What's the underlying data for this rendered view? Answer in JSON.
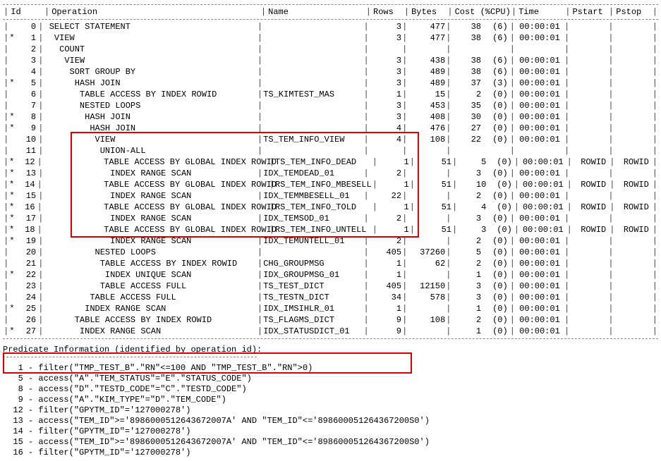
{
  "columns": {
    "id": "Id",
    "operation": "Operation",
    "name": "Name",
    "rows": "Rows",
    "bytes": "Bytes",
    "cost": "Cost (%CPU)",
    "time": "Time",
    "pstart": "Pstart",
    "pstop": "Pstop"
  },
  "plan": [
    {
      "star": "",
      "id": 0,
      "indent": 0,
      "op": "SELECT STATEMENT",
      "name": "",
      "rows": "3",
      "bytes": "477",
      "cost": "38",
      "cpu": "(6)",
      "time": "00:00:01",
      "pstart": "",
      "pstop": ""
    },
    {
      "star": "*",
      "id": 1,
      "indent": 1,
      "op": "VIEW",
      "name": "",
      "rows": "3",
      "bytes": "477",
      "cost": "38",
      "cpu": "(6)",
      "time": "00:00:01",
      "pstart": "",
      "pstop": ""
    },
    {
      "star": "",
      "id": 2,
      "indent": 2,
      "op": "COUNT",
      "name": "",
      "rows": "",
      "bytes": "",
      "cost": "",
      "cpu": "",
      "time": "",
      "pstart": "",
      "pstop": ""
    },
    {
      "star": "",
      "id": 3,
      "indent": 3,
      "op": "VIEW",
      "name": "",
      "rows": "3",
      "bytes": "438",
      "cost": "38",
      "cpu": "(6)",
      "time": "00:00:01",
      "pstart": "",
      "pstop": ""
    },
    {
      "star": "",
      "id": 4,
      "indent": 4,
      "op": "SORT GROUP BY",
      "name": "",
      "rows": "3",
      "bytes": "489",
      "cost": "38",
      "cpu": "(6)",
      "time": "00:00:01",
      "pstart": "",
      "pstop": ""
    },
    {
      "star": "*",
      "id": 5,
      "indent": 5,
      "op": "HASH JOIN",
      "name": "",
      "rows": "3",
      "bytes": "489",
      "cost": "37",
      "cpu": "(3)",
      "time": "00:00:01",
      "pstart": "",
      "pstop": ""
    },
    {
      "star": "",
      "id": 6,
      "indent": 6,
      "op": "TABLE ACCESS BY INDEX ROWID",
      "name": "TS_KIMTEST_MAS",
      "rows": "1",
      "bytes": "15",
      "cost": "2",
      "cpu": "(0)",
      "time": "00:00:01",
      "pstart": "",
      "pstop": ""
    },
    {
      "star": "",
      "id": 7,
      "indent": 6,
      "op": "NESTED LOOPS",
      "name": "",
      "rows": "3",
      "bytes": "453",
      "cost": "35",
      "cpu": "(0)",
      "time": "00:00:01",
      "pstart": "",
      "pstop": ""
    },
    {
      "star": "*",
      "id": 8,
      "indent": 7,
      "op": "HASH JOIN",
      "name": "",
      "rows": "3",
      "bytes": "408",
      "cost": "30",
      "cpu": "(0)",
      "time": "00:00:01",
      "pstart": "",
      "pstop": ""
    },
    {
      "star": "*",
      "id": 9,
      "indent": 8,
      "op": "HASH JOIN",
      "name": "",
      "rows": "4",
      "bytes": "476",
      "cost": "27",
      "cpu": "(0)",
      "time": "00:00:01",
      "pstart": "",
      "pstop": ""
    },
    {
      "star": "",
      "id": 10,
      "indent": 9,
      "op": "VIEW",
      "name": "TS_TEM_INFO_VIEW",
      "rows": "4",
      "bytes": "108",
      "cost": "22",
      "cpu": "(0)",
      "time": "00:00:01",
      "pstart": "",
      "pstop": ""
    },
    {
      "star": "",
      "id": 11,
      "indent": 10,
      "op": "UNION-ALL",
      "name": "",
      "rows": "",
      "bytes": "",
      "cost": "",
      "cpu": "",
      "time": "",
      "pstart": "",
      "pstop": ""
    },
    {
      "star": "*",
      "id": 12,
      "indent": 11,
      "op": "TABLE ACCESS BY GLOBAL INDEX ROWID",
      "name": "TS_TEM_INFO_DEAD",
      "rows": "1",
      "bytes": "51",
      "cost": "5",
      "cpu": "(0)",
      "time": "00:00:01",
      "pstart": "ROWID",
      "pstop": "ROWID"
    },
    {
      "star": "*",
      "id": 13,
      "indent": 12,
      "op": "INDEX RANGE SCAN",
      "name": "IDX_TEMDEAD_01",
      "rows": "2",
      "bytes": "",
      "cost": "3",
      "cpu": "(0)",
      "time": "00:00:01",
      "pstart": "",
      "pstop": ""
    },
    {
      "star": "*",
      "id": 14,
      "indent": 11,
      "op": "TABLE ACCESS BY GLOBAL INDEX ROWID",
      "name": "RS_TEM_INFO_MBESELL",
      "rows": "1",
      "bytes": "51",
      "cost": "10",
      "cpu": "(0)",
      "time": "00:00:01",
      "pstart": "ROWID",
      "pstop": "ROWID"
    },
    {
      "star": "*",
      "id": 15,
      "indent": 12,
      "op": "INDEX RANGE SCAN",
      "name": "IDX_TEMMBESELL_01",
      "rows": "22",
      "bytes": "",
      "cost": "2",
      "cpu": "(0)",
      "time": "00:00:01",
      "pstart": "",
      "pstop": ""
    },
    {
      "star": "*",
      "id": 16,
      "indent": 11,
      "op": "TABLE ACCESS BY GLOBAL INDEX ROWID",
      "name": "RS_TEM_INFO_TOLD",
      "rows": "1",
      "bytes": "51",
      "cost": "4",
      "cpu": "(0)",
      "time": "00:00:01",
      "pstart": "ROWID",
      "pstop": "ROWID"
    },
    {
      "star": "*",
      "id": 17,
      "indent": 12,
      "op": "INDEX RANGE SCAN",
      "name": "IDX_TEMSOD_01",
      "rows": "2",
      "bytes": "",
      "cost": "3",
      "cpu": "(0)",
      "time": "00:00:01",
      "pstart": "",
      "pstop": ""
    },
    {
      "star": "*",
      "id": 18,
      "indent": 11,
      "op": "TABLE ACCESS BY GLOBAL INDEX ROWID",
      "name": "RS_TEM_INFO_UNTELL",
      "rows": "1",
      "bytes": "51",
      "cost": "3",
      "cpu": "(0)",
      "time": "00:00:01",
      "pstart": "ROWID",
      "pstop": "ROWID"
    },
    {
      "star": "*",
      "id": 19,
      "indent": 12,
      "op": "INDEX RANGE SCAN",
      "name": "IDX_TEMUNTELL_01",
      "rows": "2",
      "bytes": "",
      "cost": "2",
      "cpu": "(0)",
      "time": "00:00:01",
      "pstart": "",
      "pstop": ""
    },
    {
      "star": "",
      "id": 20,
      "indent": 9,
      "op": "NESTED LOOPS",
      "name": "",
      "rows": "405",
      "bytes": "37260",
      "cost": "5",
      "cpu": "(0)",
      "time": "00:00:01",
      "pstart": "",
      "pstop": ""
    },
    {
      "star": "",
      "id": 21,
      "indent": 10,
      "op": "TABLE ACCESS BY INDEX ROWID",
      "name": "CHG_GROUPMSG",
      "rows": "1",
      "bytes": "62",
      "cost": "2",
      "cpu": "(0)",
      "time": "00:00:01",
      "pstart": "",
      "pstop": ""
    },
    {
      "star": "*",
      "id": 22,
      "indent": 11,
      "op": "INDEX UNIQUE SCAN",
      "name": "IDX_GROUPMSG_01",
      "rows": "1",
      "bytes": "",
      "cost": "1",
      "cpu": "(0)",
      "time": "00:00:01",
      "pstart": "",
      "pstop": ""
    },
    {
      "star": "",
      "id": 23,
      "indent": 10,
      "op": "TABLE ACCESS FULL",
      "name": "TS_TEST_DICT",
      "rows": "405",
      "bytes": "12150",
      "cost": "3",
      "cpu": "(0)",
      "time": "00:00:01",
      "pstart": "",
      "pstop": ""
    },
    {
      "star": "",
      "id": 24,
      "indent": 8,
      "op": "TABLE ACCESS FULL",
      "name": "TS_TESTN_DICT",
      "rows": "34",
      "bytes": "578",
      "cost": "3",
      "cpu": "(0)",
      "time": "00:00:01",
      "pstart": "",
      "pstop": ""
    },
    {
      "star": "*",
      "id": 25,
      "indent": 7,
      "op": "INDEX RANGE SCAN",
      "name": "IDX_IMSIHLR_01",
      "rows": "1",
      "bytes": "",
      "cost": "1",
      "cpu": "(0)",
      "time": "00:00:01",
      "pstart": "",
      "pstop": ""
    },
    {
      "star": "",
      "id": 26,
      "indent": 5,
      "op": "TABLE ACCESS BY INDEX ROWID",
      "name": "TS_FLAGMS_DICT",
      "rows": "9",
      "bytes": "108",
      "cost": "2",
      "cpu": "(0)",
      "time": "00:00:01",
      "pstart": "",
      "pstop": ""
    },
    {
      "star": "*",
      "id": 27,
      "indent": 6,
      "op": "INDEX RANGE SCAN",
      "name": "IDX_STATUSDICT_01",
      "rows": "9",
      "bytes": "",
      "cost": "1",
      "cpu": "(0)",
      "time": "00:00:01",
      "pstart": "",
      "pstop": ""
    }
  ],
  "predicate_header": "Predicate Information (identified by operation id):",
  "predicates": [
    "   1 - filter(\"TMP_TEST_B\".\"RN\"<=100 AND \"TMP_TEST_B\".\"RN\">0)",
    "   5 - access(\"A\".\"TEM_STATUS\"=\"E\".\"STATUS_CODE\")",
    "   8 - access(\"D\".\"TESTD_CODE\"=\"C\".\"TESTD_CODE\")",
    "   9 - access(\"A\".\"KIM_TYPE\"=\"D\".\"TEM_CODE\")",
    "  12 - filter(\"GPYTM_ID\"='127000278')",
    "  13 - access(\"TEM_ID\">='8986000512643672007A' AND \"TEM_ID\"<='898600051264367200S0')",
    "  14 - filter(\"GPYTM_ID\"='127000278')",
    "  15 - access(\"TEM_ID\">='8986000512643672007A' AND \"TEM_ID\"<='898600051264367200S0')",
    "  16 - filter(\"GPYTM_ID\"='127000278')"
  ]
}
